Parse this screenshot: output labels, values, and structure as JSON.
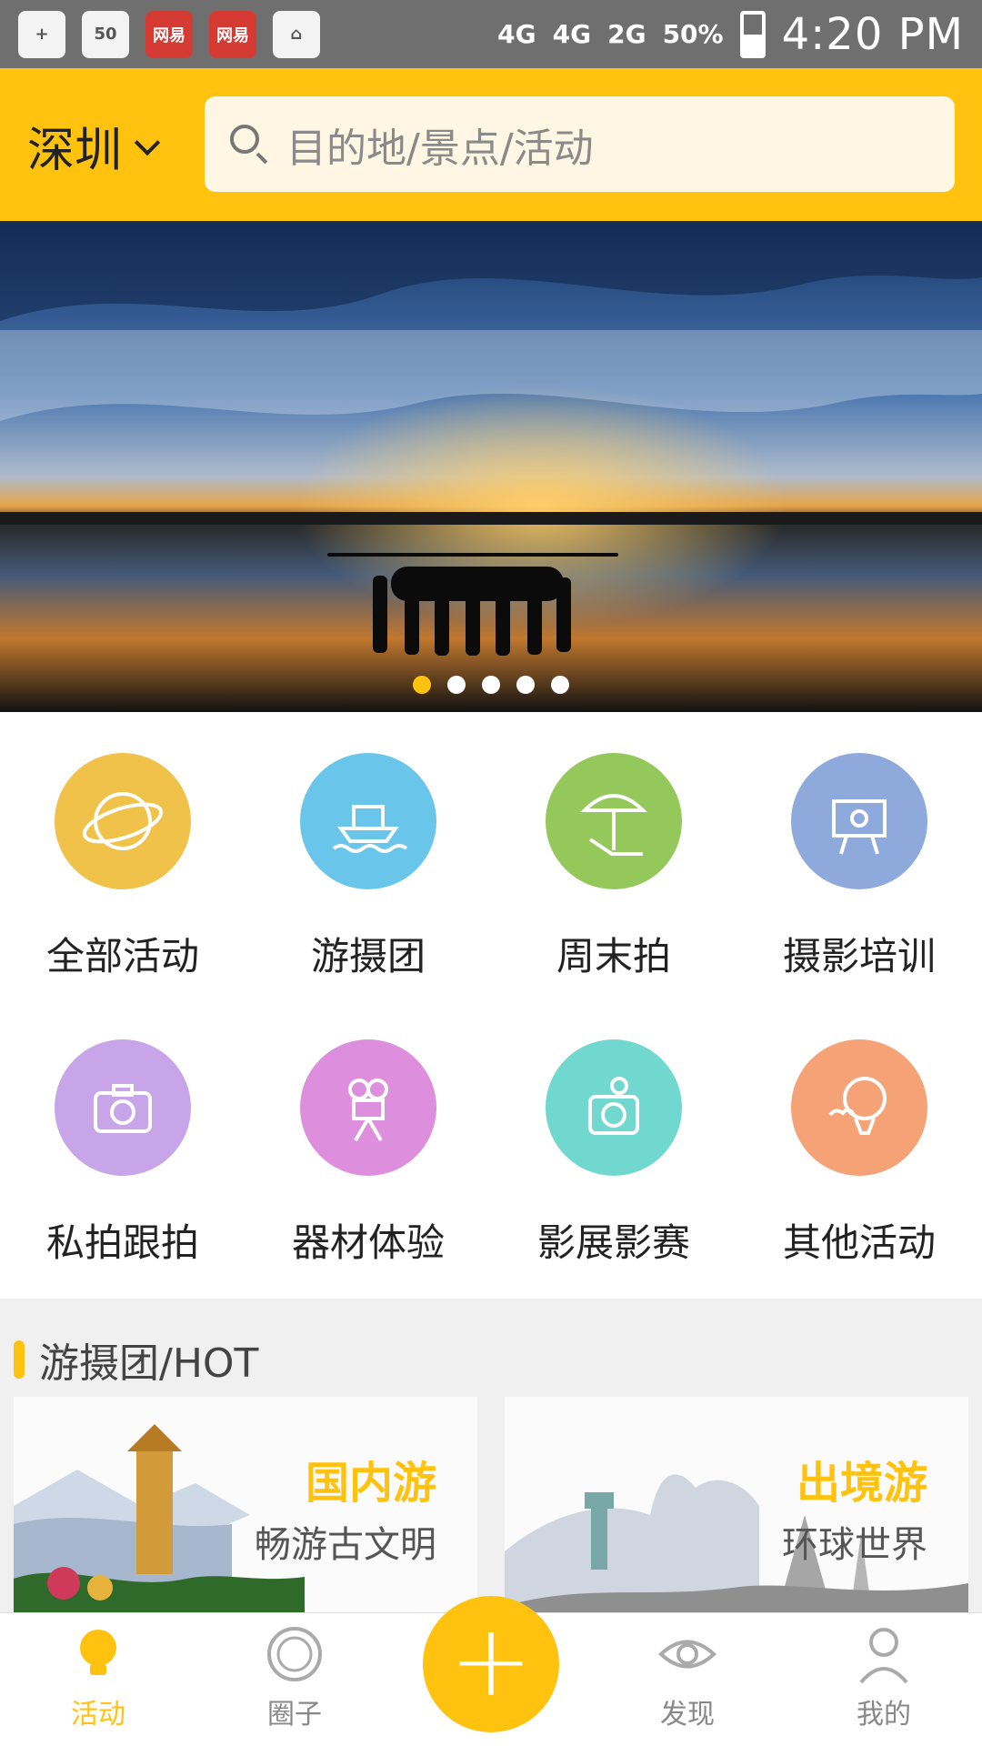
{
  "status_bar": {
    "notifications": [
      "网易",
      "网易"
    ],
    "signal_1": "4G",
    "signal_2": "4G",
    "signal_3": "2G",
    "battery": "50%",
    "time": "4:20 PM"
  },
  "header": {
    "city": "深圳",
    "search_placeholder": "目的地/景点/活动"
  },
  "banner": {
    "dots": 5,
    "active_index": 0
  },
  "categories": [
    {
      "label": "全部活动",
      "color": "#f1c24a",
      "icon": "globe-icon"
    },
    {
      "label": "游摄团",
      "color": "#69c6ea",
      "icon": "ship-icon"
    },
    {
      "label": "周末拍",
      "color": "#94c85a",
      "icon": "beach-umbrella-icon"
    },
    {
      "label": "摄影培训",
      "color": "#8ea9dc",
      "icon": "easel-camera-icon"
    },
    {
      "label": "私拍跟拍",
      "color": "#c7a5e8",
      "icon": "camera-icon"
    },
    {
      "label": "器材体验",
      "color": "#dd8fdd",
      "icon": "movie-camera-icon"
    },
    {
      "label": "影展影赛",
      "color": "#71d8cf",
      "icon": "camera-sun-icon"
    },
    {
      "label": "其他活动",
      "color": "#f5a277",
      "icon": "hot-air-balloon-icon"
    }
  ],
  "hot_section": {
    "title": "游摄团/HOT",
    "cards": [
      {
        "title": "国内游",
        "subtitle": "畅游古文明"
      },
      {
        "title": "出境游",
        "subtitle": "环球世界"
      }
    ]
  },
  "bottom_nav": {
    "tabs": [
      {
        "label": "活动",
        "icon": "lightbulb-icon",
        "active": true
      },
      {
        "label": "圈子",
        "icon": "circle-icon",
        "active": false
      },
      {
        "label": "发现",
        "icon": "eye-icon",
        "active": false
      },
      {
        "label": "我的",
        "icon": "user-icon",
        "active": false
      }
    ],
    "fab_icon": "plus-icon"
  },
  "colors": {
    "accent": "#ffc20e",
    "status_bar": "#6f6f6f"
  }
}
